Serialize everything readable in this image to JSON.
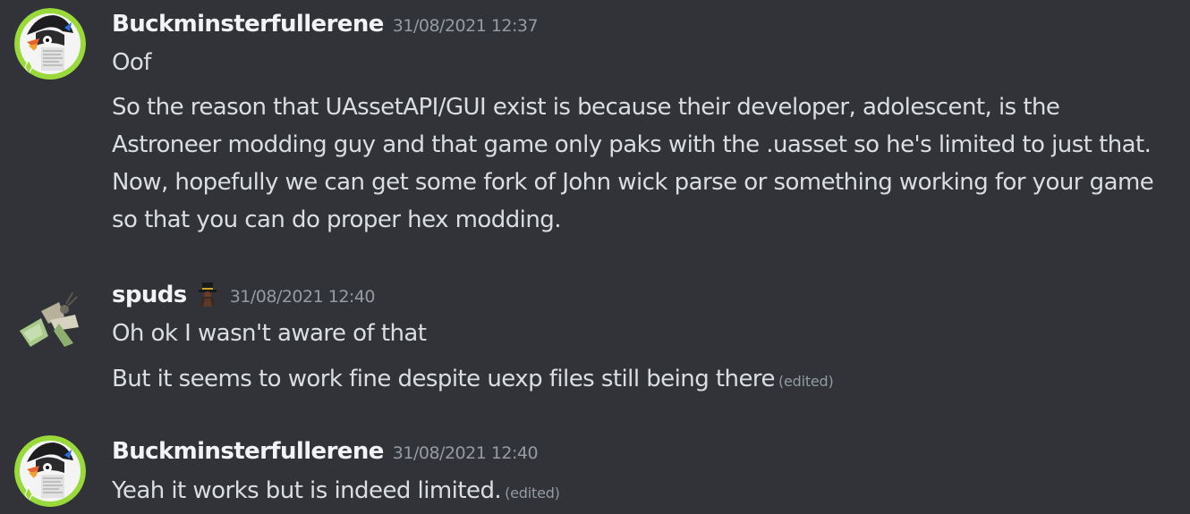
{
  "messages": [
    {
      "author": "Buckminsterfullerene",
      "avatar_icon": "puffin-avatar",
      "timestamp": "31/08/2021 12:37",
      "lines": [
        "Oof"
      ],
      "paragraph": [
        "So the reason that UAssetAPI/GUI exist is because their developer, adolescent, is the",
        "Astroneer modding guy and that game only paks with the .uasset so he's limited to just that.",
        "Now, hopefully we can get some fork of John wick parse or something working for your game",
        "so that you can do proper hex modding."
      ]
    },
    {
      "author": "spuds",
      "avatar_icon": "moth-avatar",
      "role_icon": "tophat-figure-icon",
      "timestamp": "31/08/2021 12:40",
      "line1": "Oh ok I wasn't aware of that",
      "line2": "But it seems to work fine despite uexp files still being there",
      "line2_edited": "(edited)"
    },
    {
      "author": "Buckminsterfullerene",
      "avatar_icon": "puffin-avatar",
      "timestamp": "31/08/2021 12:40",
      "line1": "Yeah it works but is indeed limited.",
      "line1_edited": "(edited)"
    }
  ],
  "colors": {
    "background": "#313338",
    "username": "#f2f3f5",
    "text": "#dbdee1",
    "muted": "#949ba4",
    "avatar_ring": "#9ad93a"
  }
}
